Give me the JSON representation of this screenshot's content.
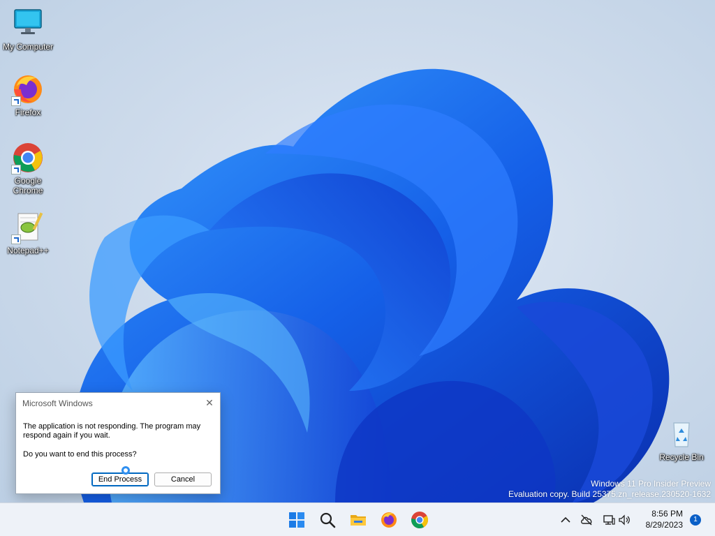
{
  "desktop": {
    "icons": [
      {
        "label": "My Computer",
        "icon": "monitor-icon"
      },
      {
        "label": "Firefox",
        "icon": "firefox-icon"
      },
      {
        "label": "Google Chrome",
        "icon": "chrome-icon"
      },
      {
        "label": "Notepad++",
        "icon": "notepadpp-icon"
      },
      {
        "label": "Recycle Bin",
        "icon": "recycle-bin-icon"
      }
    ],
    "watermark": {
      "line1": "Windows 11 Pro Insider Preview",
      "line2": "Evaluation copy. Build 25375.zn_release.230520-1632"
    }
  },
  "dialog": {
    "title": "Microsoft Windows",
    "close_label": "✕",
    "message": "The application is not responding. The program may respond again if you wait.",
    "question": "Do you want to end this process?",
    "end_process_label": "End Process",
    "cancel_label": "Cancel"
  },
  "taskbar": {
    "apps": [
      "start-icon",
      "search-icon",
      "file-explorer-icon",
      "firefox-icon",
      "chrome-icon"
    ],
    "tray": {
      "time": "8:56 PM",
      "date": "8/29/2023",
      "notification_count": "1"
    }
  },
  "colors": {
    "accent": "#0067c0",
    "wallpaper_blue": "#1a5fe0"
  }
}
